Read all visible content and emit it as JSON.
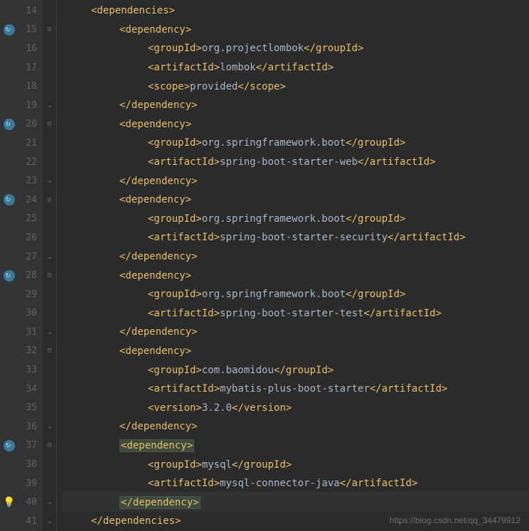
{
  "watermark": "https://blog.csdn.net/qq_34479912",
  "lines": [
    {
      "n": 14,
      "indent": 1,
      "tokens": [
        {
          "t": "tag",
          "v": "<dependencies>"
        }
      ]
    },
    {
      "n": 15,
      "indent": 2,
      "icon": "refresh",
      "fold": "open",
      "tokens": [
        {
          "t": "tag",
          "v": "<dependency>"
        }
      ]
    },
    {
      "n": 16,
      "indent": 3,
      "tokens": [
        {
          "t": "tag",
          "v": "<groupId>"
        },
        {
          "t": "text",
          "v": "org.projectlombok"
        },
        {
          "t": "tag",
          "v": "</groupId>"
        }
      ]
    },
    {
      "n": 17,
      "indent": 3,
      "tokens": [
        {
          "t": "tag",
          "v": "<artifactId>"
        },
        {
          "t": "text",
          "v": "lombok"
        },
        {
          "t": "tag",
          "v": "</artifactId>"
        }
      ]
    },
    {
      "n": 18,
      "indent": 3,
      "tokens": [
        {
          "t": "tag",
          "v": "<scope>"
        },
        {
          "t": "text",
          "v": "provided"
        },
        {
          "t": "tag",
          "v": "</scope>"
        }
      ]
    },
    {
      "n": 19,
      "indent": 2,
      "fold": "close",
      "tokens": [
        {
          "t": "tag",
          "v": "</dependency>"
        }
      ]
    },
    {
      "n": 20,
      "indent": 2,
      "icon": "refresh",
      "fold": "open",
      "tokens": [
        {
          "t": "tag",
          "v": "<dependency>"
        }
      ]
    },
    {
      "n": 21,
      "indent": 3,
      "tokens": [
        {
          "t": "tag",
          "v": "<groupId>"
        },
        {
          "t": "text",
          "v": "org.springframework.boot"
        },
        {
          "t": "tag",
          "v": "</groupId>"
        }
      ]
    },
    {
      "n": 22,
      "indent": 3,
      "tokens": [
        {
          "t": "tag",
          "v": "<artifactId>"
        },
        {
          "t": "text",
          "v": "spring-boot-starter-web"
        },
        {
          "t": "tag",
          "v": "</artifactId>"
        }
      ]
    },
    {
      "n": 23,
      "indent": 2,
      "fold": "close",
      "tokens": [
        {
          "t": "tag",
          "v": "</dependency>"
        }
      ]
    },
    {
      "n": 24,
      "indent": 2,
      "icon": "refresh",
      "fold": "open",
      "tokens": [
        {
          "t": "tag",
          "v": "<dependency>"
        }
      ]
    },
    {
      "n": 25,
      "indent": 3,
      "tokens": [
        {
          "t": "tag",
          "v": "<groupId>"
        },
        {
          "t": "text",
          "v": "org.springframework.boot"
        },
        {
          "t": "tag",
          "v": "</groupId>"
        }
      ]
    },
    {
      "n": 26,
      "indent": 3,
      "tokens": [
        {
          "t": "tag",
          "v": "<artifactId>"
        },
        {
          "t": "text",
          "v": "spring-boot-starter-security"
        },
        {
          "t": "tag",
          "v": "</artifactId>"
        }
      ]
    },
    {
      "n": 27,
      "indent": 2,
      "fold": "close",
      "tokens": [
        {
          "t": "tag",
          "v": "</dependency>"
        }
      ]
    },
    {
      "n": 28,
      "indent": 2,
      "icon": "refresh",
      "fold": "open",
      "tokens": [
        {
          "t": "tag",
          "v": "<dependency>"
        }
      ]
    },
    {
      "n": 29,
      "indent": 3,
      "tokens": [
        {
          "t": "tag",
          "v": "<groupId>"
        },
        {
          "t": "text",
          "v": "org.springframework.boot"
        },
        {
          "t": "tag",
          "v": "</groupId>"
        }
      ]
    },
    {
      "n": 30,
      "indent": 3,
      "tokens": [
        {
          "t": "tag",
          "v": "<artifactId>"
        },
        {
          "t": "text",
          "v": "spring-boot-starter-test"
        },
        {
          "t": "tag",
          "v": "</artifactId>"
        }
      ]
    },
    {
      "n": 31,
      "indent": 2,
      "fold": "close",
      "tokens": [
        {
          "t": "tag",
          "v": "</dependency>"
        }
      ]
    },
    {
      "n": 32,
      "indent": 2,
      "fold": "open",
      "tokens": [
        {
          "t": "tag",
          "v": "<dependency>"
        }
      ]
    },
    {
      "n": 33,
      "indent": 3,
      "tokens": [
        {
          "t": "tag",
          "v": "<groupId>"
        },
        {
          "t": "text",
          "v": "com.baomidou"
        },
        {
          "t": "tag",
          "v": "</groupId>"
        }
      ]
    },
    {
      "n": 34,
      "indent": 3,
      "tokens": [
        {
          "t": "tag",
          "v": "<artifactId>"
        },
        {
          "t": "text",
          "v": "mybatis-plus-boot-starter"
        },
        {
          "t": "tag",
          "v": "</artifactId>"
        }
      ]
    },
    {
      "n": 35,
      "indent": 3,
      "tokens": [
        {
          "t": "tag",
          "v": "<version>"
        },
        {
          "t": "text",
          "v": "3.2.0"
        },
        {
          "t": "tag",
          "v": "</version>"
        }
      ]
    },
    {
      "n": 36,
      "indent": 2,
      "fold": "close",
      "tokens": [
        {
          "t": "tag",
          "v": "</dependency>"
        }
      ]
    },
    {
      "n": 37,
      "indent": 2,
      "icon": "refresh",
      "fold": "open",
      "hl": true,
      "tokens": [
        {
          "t": "tag",
          "v": "<dependency>",
          "hl": true
        }
      ]
    },
    {
      "n": 38,
      "indent": 3,
      "tokens": [
        {
          "t": "tag",
          "v": "<groupId>"
        },
        {
          "t": "text",
          "v": "mysql"
        },
        {
          "t": "tag",
          "v": "</groupId>"
        }
      ]
    },
    {
      "n": 39,
      "indent": 3,
      "tokens": [
        {
          "t": "tag",
          "v": "<artifactId>"
        },
        {
          "t": "text",
          "v": "mysql-connector-java"
        },
        {
          "t": "tag",
          "v": "</artifactId>"
        }
      ]
    },
    {
      "n": 40,
      "indent": 2,
      "icon": "bulb",
      "fold": "close",
      "current": true,
      "tokens": [
        {
          "t": "tag",
          "v": "</dependency>",
          "hl": true
        }
      ]
    },
    {
      "n": 41,
      "indent": 1,
      "fold": "close",
      "tokens": [
        {
          "t": "tag",
          "v": "</dependencies>"
        }
      ]
    }
  ]
}
